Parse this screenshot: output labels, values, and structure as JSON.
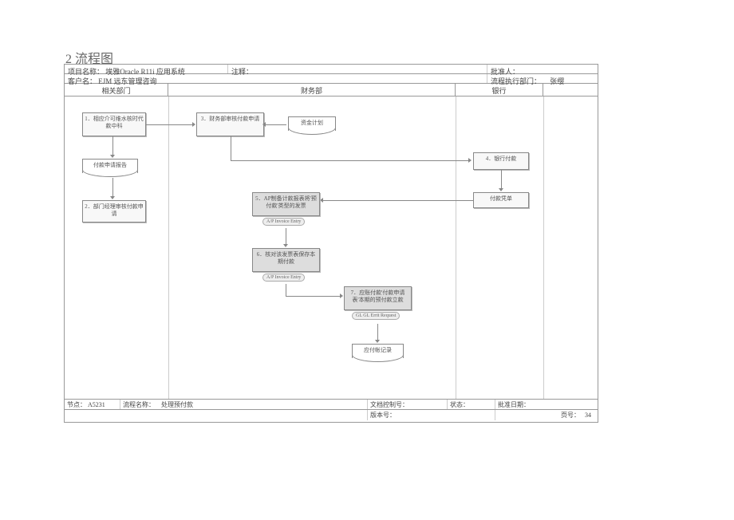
{
  "heading": "2 流程图",
  "header": {
    "project_label": "项目名称：",
    "project_value": "埃雅Oracle R11i 应用系统",
    "client_label": "客户名：",
    "client_value": "EJM 远东管理咨询",
    "note_label": "注释：",
    "approver_label": "批准人：",
    "exec_dept_label": "流程执行部门：",
    "zhang_ying": "张缨"
  },
  "lanes": {
    "lane1": "相关部门",
    "lane2": "财务部",
    "lane3": "银行"
  },
  "boxes": {
    "b1": "1．相应介可维水核时代款中科",
    "b2": "付款申请报告",
    "b3": "2．部门经理审核付款申请",
    "b4": "3．财务部审核付款申请",
    "b5": "资金计划",
    "b6": "4．银行付款",
    "b7": "付款凭单",
    "b8": "5．AP制备计款报表将'预付款'类型的发票",
    "b8_tag": "A/P Invoice Entry",
    "b9": "6．核对该发票表保存本期付款",
    "b9_tag": "A/P Invoice Entry",
    "b10": "7．应账付款'付款申请表'本期的预付款立款",
    "b10_tag": "GL GL Errit Request",
    "b11": "应付帐记录"
  },
  "footer": {
    "node_label": "节点：",
    "node_value": "A5231",
    "flow_label": "流程名称：",
    "flow_value": "处理预付款",
    "docctrl_label": "文档控制号：",
    "version_label": "版本号：",
    "status_label": "状态：",
    "approve_date_label": "批准日期：",
    "page_label": "页号：",
    "page_value": "34"
  }
}
